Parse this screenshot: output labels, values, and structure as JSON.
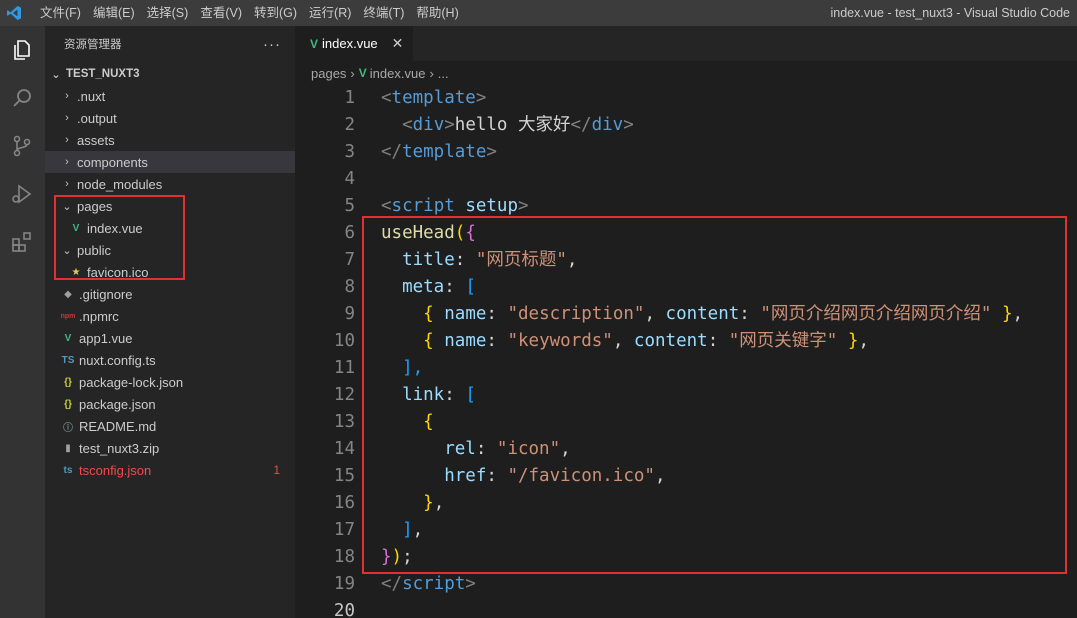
{
  "titlebar": {
    "menu": [
      "文件(F)",
      "编辑(E)",
      "选择(S)",
      "查看(V)",
      "转到(G)",
      "运行(R)",
      "终端(T)",
      "帮助(H)"
    ],
    "window_title": "index.vue - test_nuxt3 - Visual Studio Code"
  },
  "activitybar": {
    "icons": [
      "explorer-icon",
      "search-icon",
      "source-control-icon",
      "run-debug-icon",
      "extensions-icon"
    ]
  },
  "sidebar": {
    "title": "资源管理器",
    "more": "···",
    "root": "TEST_NUXT3",
    "items": [
      {
        "label": ".nuxt",
        "type": "folder",
        "chevron": "›",
        "icon": "",
        "color": "#cccccc"
      },
      {
        "label": ".output",
        "type": "folder",
        "chevron": "›",
        "icon": "",
        "color": "#cccccc"
      },
      {
        "label": "assets",
        "type": "folder",
        "chevron": "›",
        "icon": "",
        "color": "#cccccc"
      },
      {
        "label": "components",
        "type": "folder",
        "chevron": "›",
        "icon": "",
        "color": "#cccccc"
      },
      {
        "label": "node_modules",
        "type": "folder",
        "chevron": "›",
        "icon": "",
        "color": "#cccccc"
      },
      {
        "label": "pages",
        "type": "folder-open",
        "chevron": "⌄",
        "icon": "",
        "color": "#cccccc"
      },
      {
        "label": "index.vue",
        "type": "vue",
        "chevron": "",
        "icon": "V",
        "color": "#cccccc"
      },
      {
        "label": "public",
        "type": "folder-open",
        "chevron": "⌄",
        "icon": "",
        "color": "#cccccc"
      },
      {
        "label": "favicon.ico",
        "type": "favicon",
        "chevron": "",
        "icon": "★",
        "color": "#cccccc"
      },
      {
        "label": ".gitignore",
        "type": "git",
        "chevron": "",
        "icon": "◆",
        "color": "#cccccc"
      },
      {
        "label": ".npmrc",
        "type": "npm",
        "chevron": "",
        "icon": "npm",
        "color": "#cccccc"
      },
      {
        "label": "app1.vue",
        "type": "vue",
        "chevron": "",
        "icon": "V",
        "color": "#cccccc"
      },
      {
        "label": "nuxt.config.ts",
        "type": "ts",
        "chevron": "",
        "icon": "TS",
        "color": "#cccccc"
      },
      {
        "label": "package-lock.json",
        "type": "json",
        "chevron": "",
        "icon": "{}",
        "color": "#cccccc"
      },
      {
        "label": "package.json",
        "type": "json",
        "chevron": "",
        "icon": "{}",
        "color": "#cccccc"
      },
      {
        "label": "README.md",
        "type": "info",
        "chevron": "",
        "icon": "ⓘ",
        "color": "#cccccc"
      },
      {
        "label": "test_nuxt3.zip",
        "type": "zip",
        "chevron": "",
        "icon": "▮",
        "color": "#cccccc"
      },
      {
        "label": "tsconfig.json",
        "type": "tsconfig",
        "chevron": "",
        "icon": "ts",
        "color": "#f14c4c",
        "badge": "1"
      }
    ]
  },
  "editor": {
    "tab": {
      "label": "index.vue",
      "close": "✕"
    },
    "breadcrumbs": [
      "pages",
      "index.vue",
      "..."
    ],
    "line_numbers": [
      "1",
      "2",
      "3",
      "4",
      "5",
      "6",
      "7",
      "8",
      "9",
      "10",
      "11",
      "12",
      "13",
      "14",
      "15",
      "16",
      "17",
      "18",
      "19",
      "20"
    ]
  },
  "colors": {
    "highlight_box": "#e0312f",
    "vue_green": "#41b883",
    "vscode_blue": "#2f9ae3"
  }
}
